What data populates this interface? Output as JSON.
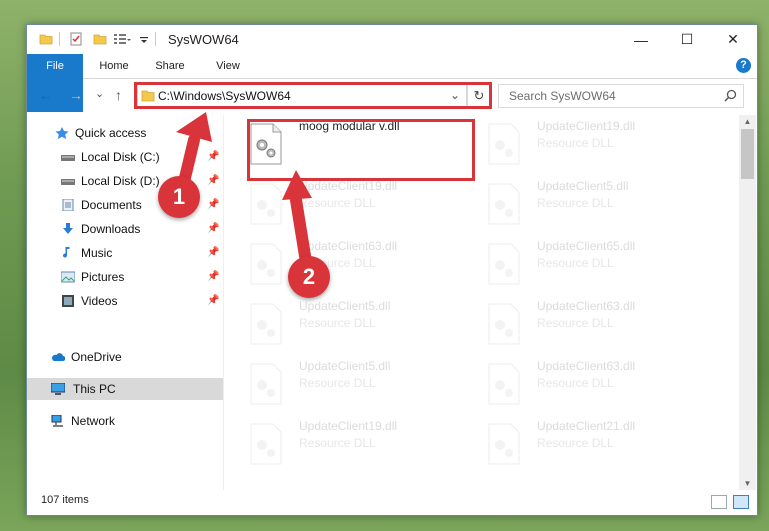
{
  "window": {
    "title": "SysWOW64",
    "minimize": "—",
    "maximize": "☐",
    "close": "✕"
  },
  "ribbon": {
    "tabs": [
      "File",
      "Home",
      "Share",
      "View"
    ],
    "help": "?"
  },
  "nav": {
    "back": "←",
    "forward": "→",
    "recent": "⌄",
    "up": "↑",
    "address": "C:\\Windows\\SysWOW64",
    "address_dropdown": "⌄",
    "refresh": "↻",
    "search_placeholder": "Search SysWOW64",
    "search_icon": "search-icon"
  },
  "sidebar": {
    "items": [
      {
        "label": "Quick access",
        "icon": "star-icon"
      },
      {
        "label": "Local Disk (C:)",
        "icon": "drive-icon",
        "pinned": true
      },
      {
        "label": "Local Disk (D:)",
        "icon": "drive-icon",
        "pinned": true
      },
      {
        "label": "Documents",
        "icon": "documents-icon",
        "pinned": true
      },
      {
        "label": "Downloads",
        "icon": "download-icon",
        "pinned": true
      },
      {
        "label": "Music",
        "icon": "music-icon",
        "pinned": true
      },
      {
        "label": "Pictures",
        "icon": "pictures-icon",
        "pinned": true
      },
      {
        "label": "Videos",
        "icon": "videos-icon",
        "pinned": true
      },
      {
        "label": "OneDrive",
        "icon": "cloud-icon"
      },
      {
        "label": "This PC",
        "icon": "computer-icon",
        "selected": true
      },
      {
        "label": "Network",
        "icon": "network-icon"
      }
    ],
    "pin_glyph": "📌"
  },
  "files": {
    "highlighted": {
      "name": "moog modular v.dll"
    },
    "left_column": [
      {
        "name": "UpdateClient19.dll",
        "type": "Resource DLL"
      },
      {
        "name": "UpdateClient63.dll",
        "type": "Resource DLL"
      },
      {
        "name": "UpdateClient5.dll",
        "type": "Resource DLL"
      },
      {
        "name": "UpdateClient5.dll",
        "type": "Resource DLL"
      },
      {
        "name": "UpdateClient19.dll",
        "type": "Resource DLL"
      }
    ],
    "right_column": [
      {
        "name": "UpdateClient19.dll",
        "type": "Resource DLL"
      },
      {
        "name": "UpdateClient5.dll",
        "type": "Resource DLL"
      },
      {
        "name": "UpdateClient65.dll",
        "type": "Resource DLL"
      },
      {
        "name": "UpdateClient63.dll",
        "type": "Resource DLL"
      },
      {
        "name": "UpdateClient63.dll",
        "type": "Resource DLL"
      },
      {
        "name": "UpdateClient21.dll",
        "type": "Resource DLL"
      }
    ]
  },
  "status": {
    "count": "107 items"
  },
  "callouts": [
    "1",
    "2"
  ],
  "colors": {
    "accent": "#1979ca",
    "highlight_red": "#d8343a",
    "selected_bg": "#d9d9d9"
  }
}
